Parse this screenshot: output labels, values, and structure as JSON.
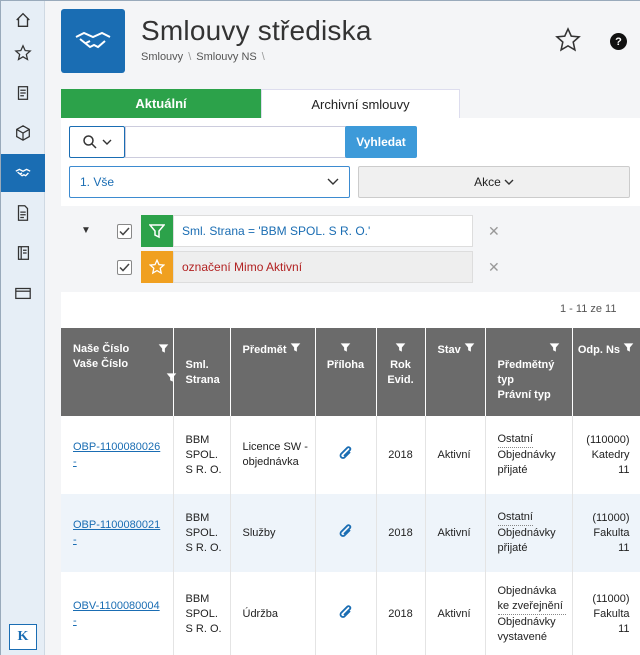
{
  "page": {
    "title": "Smlouvy střediska",
    "breadcrumb": [
      "Smlouvy",
      "Smlouvy NS"
    ]
  },
  "tabs": [
    {
      "label": "Aktuální",
      "active": true
    },
    {
      "label": "Archivní smlouvy",
      "active": false
    }
  ],
  "search": {
    "button": "Vyhledat",
    "value": ""
  },
  "select": {
    "value": "1. Vše"
  },
  "akce": {
    "label": "Akce"
  },
  "filters": [
    {
      "text": "Sml. Strana = 'BBM SPOL. S R. O.'",
      "icon": "filter-icon",
      "color": "#2ca24a"
    },
    {
      "text": "označení Mimo Aktivní",
      "icon": "star-icon",
      "color": "#f0a020"
    }
  ],
  "count": "1 - 11 ze 11",
  "columns": [
    {
      "line1": "Naše Číslo",
      "line2": "Vaše Číslo"
    },
    {
      "line1": "Sml. Strana",
      "line2": ""
    },
    {
      "line1": "Předmět",
      "line2": ""
    },
    {
      "line1": "Příloha",
      "line2": ""
    },
    {
      "line1": "Rok Evid.",
      "line2": ""
    },
    {
      "line1": "Stav",
      "line2": ""
    },
    {
      "line1": "Předmětný typ",
      "line2": "Právní typ"
    },
    {
      "line1": "Odp. Ns",
      "line2": ""
    }
  ],
  "rows": [
    {
      "cislo": "OBP-1100080026",
      "cislo2": "-",
      "strana": "BBM SPOL. S R. O.",
      "predmet": "Licence SW - objednávka",
      "rok": "2018",
      "stav": "Aktivní",
      "typ1": "Ostatní",
      "typ2": "Objednávky přijaté",
      "odp1": "(110000)",
      "odp2": "Katedry 11"
    },
    {
      "cislo": "OBP-1100080021",
      "cislo2": "-",
      "strana": "BBM SPOL. S R. O.",
      "predmet": "Služby",
      "rok": "2018",
      "stav": "Aktivní",
      "typ1": "Ostatní",
      "typ2": "Objednávky přijaté",
      "odp1": "(11000)",
      "odp2": "Fakulta 11"
    },
    {
      "cislo": "OBV-1100080004",
      "cislo2": "-",
      "strana": "BBM SPOL. S R. O.",
      "predmet": "Údržba",
      "rok": "2018",
      "stav": "Aktivní",
      "typ1": "Objednávka ke zveřejnění",
      "typ2": "Objednávky vystavené",
      "odp1": "(11000)",
      "odp2": "Fakulta 11"
    }
  ],
  "colors": {
    "accent": "#1a6db3",
    "active_tab": "#2ca24a",
    "header": "#6b6b6b"
  }
}
